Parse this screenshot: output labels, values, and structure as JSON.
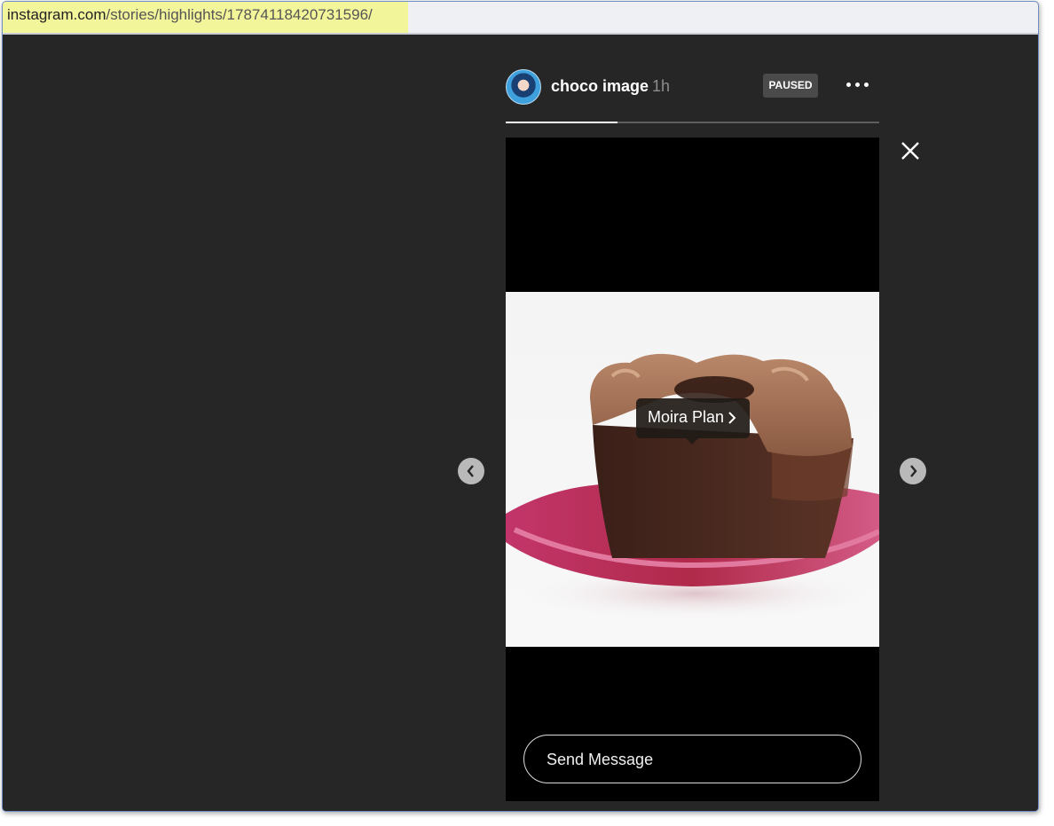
{
  "browser": {
    "url_domain": "instagram.com",
    "url_path": "/stories/highlights/17874118420731596/"
  },
  "story": {
    "username": "choco image",
    "time_ago": "1h",
    "status_badge": "PAUSED",
    "progress_fraction": 0.3,
    "tag_label": "Moira Plan",
    "message_placeholder": "Send Message"
  },
  "icons": {
    "more": "more-options-icon",
    "close": "close-icon",
    "prev": "chevron-left-icon",
    "next": "chevron-right-icon",
    "tag_chevron": "chevron-right-icon"
  },
  "colors": {
    "background": "#262626",
    "story_background": "#000000",
    "progress_fill": "#ffffff",
    "progress_track": "#5e5e5e",
    "url_highlight": "#f3f59a"
  }
}
